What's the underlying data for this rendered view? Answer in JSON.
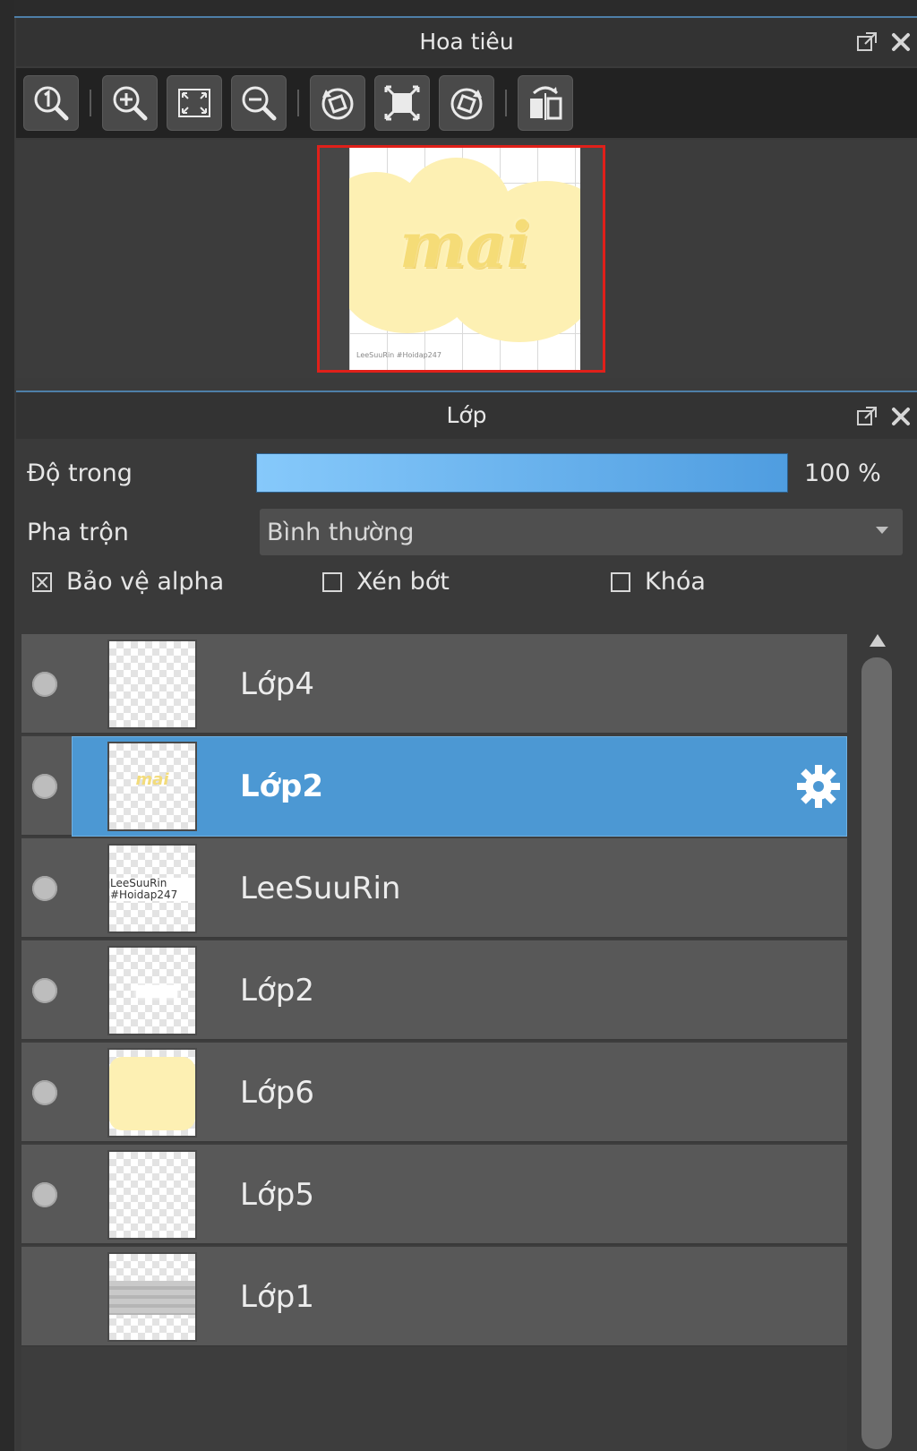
{
  "navigator": {
    "title": "Hoa tiêu",
    "preview_text": "mai",
    "preview_watermark": "LeeSuuRin #Hoidap247"
  },
  "layers_panel": {
    "title": "Lớp",
    "opacity_label": "Độ trong",
    "opacity_value": "100 %",
    "opacity_fraction": 1.0,
    "blend_label": "Pha trộn",
    "blend_value": "Bình thường",
    "options": {
      "protect_alpha": {
        "label": "Bảo vệ alpha",
        "checked": true
      },
      "clipping": {
        "label": "Xén bớt",
        "checked": false
      },
      "lock": {
        "label": "Khóa",
        "checked": false
      }
    },
    "layers": [
      {
        "name": "Lớp4",
        "thumb": "empty",
        "visible": true,
        "selected": false
      },
      {
        "name": "Lớp2",
        "thumb": "text",
        "visible": true,
        "selected": true
      },
      {
        "name": "LeeSuuRin",
        "thumb": "watermark",
        "visible": true,
        "selected": false
      },
      {
        "name": "Lớp2",
        "thumb": "white",
        "visible": true,
        "selected": false
      },
      {
        "name": "Lớp6",
        "thumb": "yellow",
        "visible": true,
        "selected": false
      },
      {
        "name": "Lớp5",
        "thumb": "empty",
        "visible": true,
        "selected": false
      },
      {
        "name": "Lớp1",
        "thumb": "gray",
        "visible": false,
        "selected": false
      }
    ],
    "thumb_texts": {
      "text": "mai",
      "watermark": "LeeSuuRin #Hoidap247"
    }
  },
  "colors": {
    "selection": "#4c98d3",
    "opacity_start": "#86c9fb",
    "opacity_end": "#4f9de0",
    "viewport_frame": "#e0201a",
    "accent_line": "#4e7fa8"
  },
  "icons": {
    "panel_controls": [
      "popout-icon",
      "close-icon"
    ],
    "toolbar": [
      "zoom-actual-icon",
      "zoom-in-icon",
      "fit-screen-icon",
      "zoom-out-icon",
      "rotate-left-icon",
      "fit-window-icon",
      "rotate-right-icon",
      "flip-horizontal-icon"
    ],
    "layer_settings": "gear-icon"
  }
}
